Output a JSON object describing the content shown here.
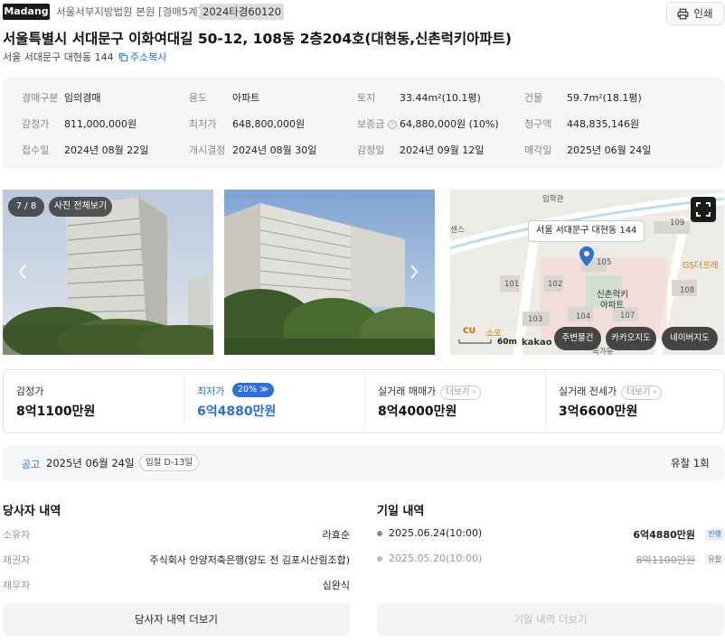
{
  "header": {
    "logo": "Madang",
    "court": "서울서부지방법원 본원 [경매5계]",
    "case_no": "2024타경60120",
    "print_label": "인쇄"
  },
  "property": {
    "title": "서울특별시 서대문구 이화여대길 50-12, 108동 2층204호(대현동,신촌럭키아파트)",
    "address_short": "서울 서대문구 대현동 144",
    "copy_label": "주소복사"
  },
  "info": [
    [
      {
        "label": "경매구분",
        "value": "임의경매"
      },
      {
        "label": "용도",
        "value": "아파트"
      },
      {
        "label": "토지",
        "value": "33.44m²(10.1평)"
      },
      {
        "label": "건물",
        "value": "59.7m²(18.1평)"
      }
    ],
    [
      {
        "label": "감정가",
        "value": "811,000,000원"
      },
      {
        "label": "최저가",
        "value": "648,800,000원"
      },
      {
        "label": "보증금",
        "value": "64,880,000원 (10%)"
      },
      {
        "label": "청구액",
        "value": "448,835,146원"
      }
    ],
    [
      {
        "label": "접수일",
        "value": "2024년 08월 22일"
      },
      {
        "label": "개시결정",
        "value": "2024년 08월 30일"
      },
      {
        "label": "감정일",
        "value": "2024년 09월 12일"
      },
      {
        "label": "매각일",
        "value": "2025년 06월 24일"
      }
    ]
  ],
  "gallery": {
    "counter": "7 / 8",
    "view_all": "사진 전체보기"
  },
  "map": {
    "popup": "서울 서대문구 대현동 144",
    "scale": "60m",
    "provider": "kakao",
    "labels": [
      "입학관",
      "109",
      "101",
      "102",
      "105",
      "103",
      "104",
      "107",
      "108",
      "신촌럭키",
      "아파트",
      "GS더프레",
      "CU",
      "소오",
      "곡가유",
      "센스"
    ],
    "buttons": [
      "주변물건",
      "카카오지도",
      "네이버지도"
    ]
  },
  "prices": [
    {
      "label": "감정가",
      "value": "8억1100만원"
    },
    {
      "label": "최저가",
      "value": "6억4880만원",
      "badge": "20%"
    },
    {
      "label": "실거래 매매가",
      "value": "8억4000만원",
      "more": "더보기"
    },
    {
      "label": "실거래 전세가",
      "value": "3억6600만원",
      "more": "더보기"
    }
  ],
  "notice": {
    "label": "공고",
    "date": "2025년 06월 24일",
    "dday": "입찰 D-13일",
    "result": "유찰 1회"
  },
  "parties": {
    "title": "당사자 내역",
    "rows": [
      {
        "label": "소유자",
        "value": "라효순"
      },
      {
        "label": "채권자",
        "value": "주식회사 안양저축은행(양도 전 김포시산림조합)"
      },
      {
        "label": "채무자",
        "value": "심완식"
      }
    ],
    "more_label": "당사자 내역 더보기"
  },
  "history": {
    "title": "기일 내역",
    "rows": [
      {
        "date": "2025.06.24(10:00)",
        "price": "6억4880만원",
        "status": "진행"
      },
      {
        "date": "2025.05.20(10:00)",
        "price": "8억1100만원",
        "status": "유찰"
      }
    ],
    "more_label": "기일 내역 더보기"
  },
  "colors": {
    "accent": "#2f6fd8",
    "dark": "#1a1a1a",
    "box_bg": "#f5f6f8"
  }
}
